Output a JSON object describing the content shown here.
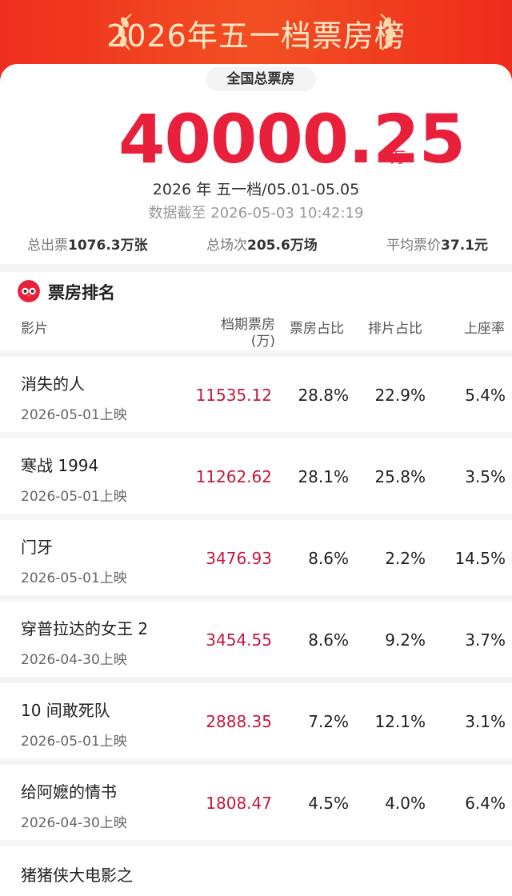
{
  "banner": {
    "title": "2026年五一档票房榜"
  },
  "summary": {
    "total_label": "全国总票房",
    "total_value": "40000.25",
    "total_unit": "万",
    "period": "2026 年 五一档/05.01-05.05",
    "updated": "数据截至 2026-05-03 10:42:19",
    "tickets_label": "总出票",
    "tickets_value": "1076.3万张",
    "shows_label": "总场次",
    "shows_value": "205.6万场",
    "avg_price_label": "平均票价",
    "avg_price_value": "37.1元"
  },
  "ranking": {
    "title": "票房排名",
    "headers": {
      "film": "影片",
      "box_line1": "档期票房",
      "box_line2": "(万)",
      "box_share": "票房占比",
      "screen_share": "排片占比",
      "occupancy": "上座率"
    },
    "rows": [
      {
        "name": "消失的人",
        "date": "2026-05-01上映",
        "box": "11535.12",
        "box_share": "28.8%",
        "screen_share": "22.9%",
        "occupancy": "5.4%"
      },
      {
        "name": "寒战 1994",
        "date": "2026-05-01上映",
        "box": "11262.62",
        "box_share": "28.1%",
        "screen_share": "25.8%",
        "occupancy": "3.5%"
      },
      {
        "name": "门牙",
        "date": "2026-05-01上映",
        "box": "3476.93",
        "box_share": "8.6%",
        "screen_share": "2.2%",
        "occupancy": "14.5%"
      },
      {
        "name": "穿普拉达的女王 2",
        "date": "2026-04-30上映",
        "box": "3454.55",
        "box_share": "8.6%",
        "screen_share": "9.2%",
        "occupancy": "3.7%"
      },
      {
        "name": "10 间敢死队",
        "date": "2026-05-01上映",
        "box": "2888.35",
        "box_share": "7.2%",
        "screen_share": "12.1%",
        "occupancy": "3.1%"
      },
      {
        "name": "给阿嬷的情书",
        "date": "2026-04-30上映",
        "box": "1808.47",
        "box_share": "4.5%",
        "screen_share": "4.0%",
        "occupancy": "6.4%"
      },
      {
        "name": "猪猪侠大电影之",
        "date": "",
        "box": "",
        "box_share": "",
        "screen_share": "",
        "occupancy": ""
      }
    ]
  }
}
